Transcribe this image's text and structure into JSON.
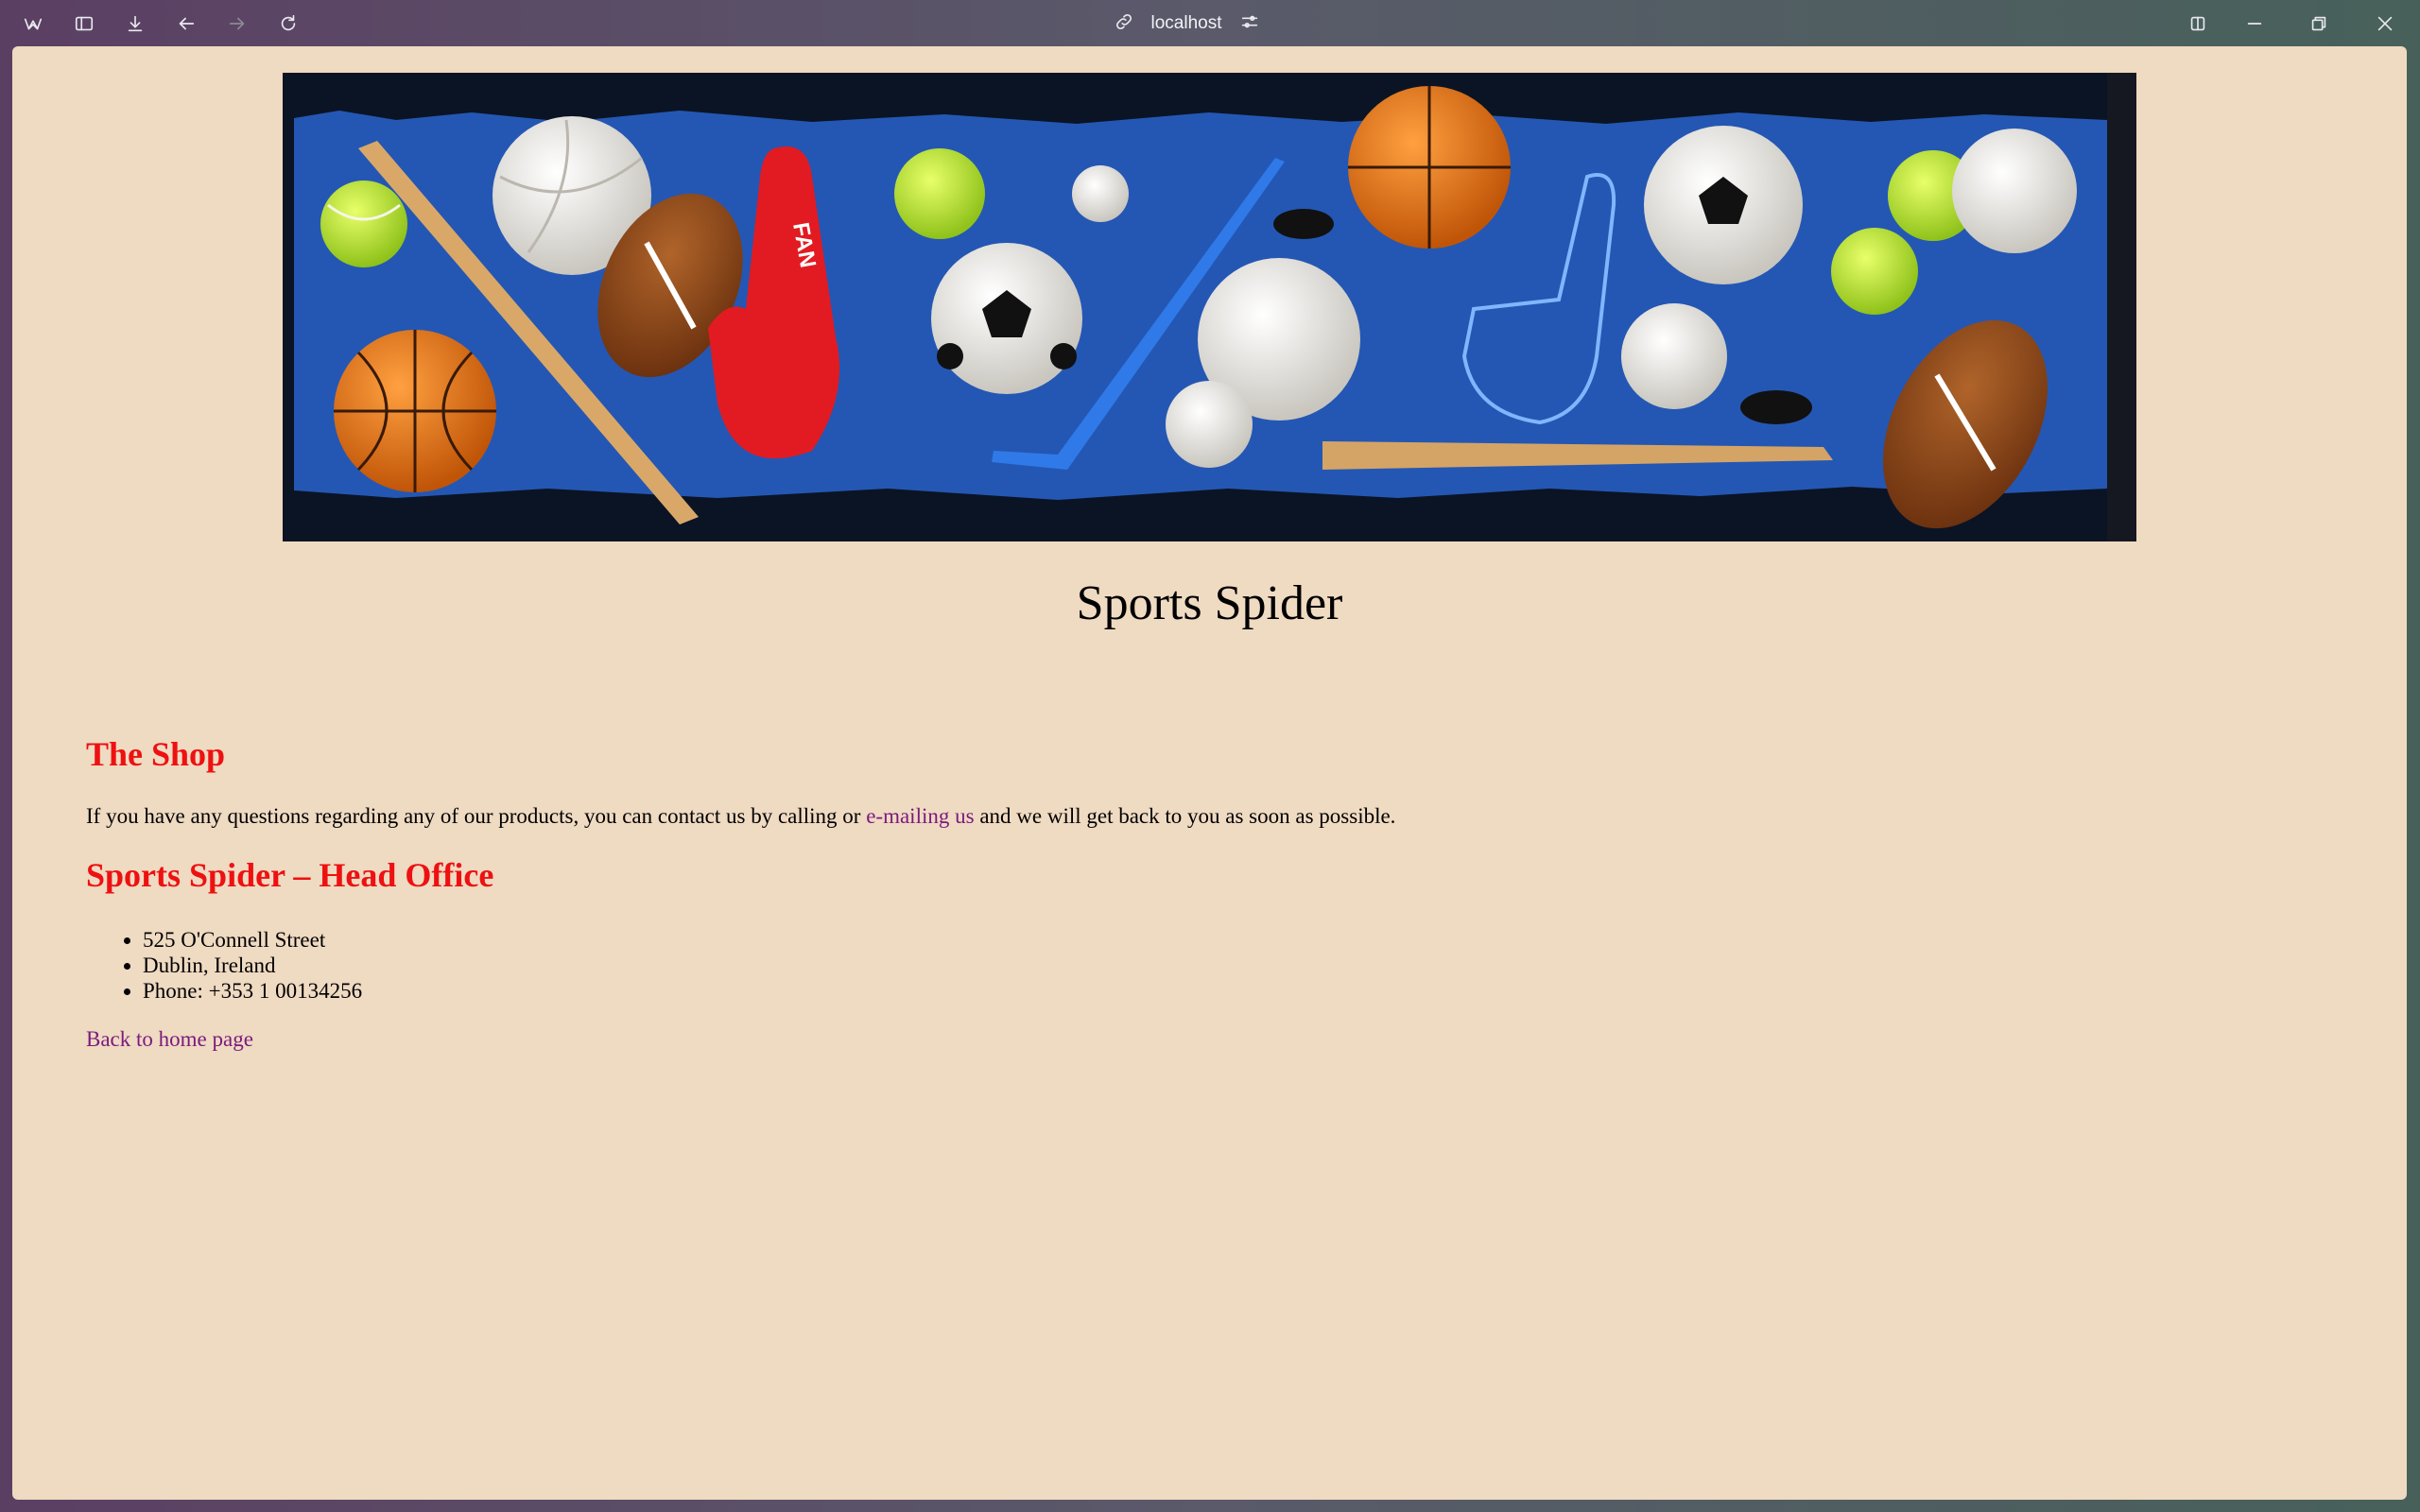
{
  "browser": {
    "url": "localhost",
    "icons": [
      "app-logo-icon",
      "sidebar-icon",
      "download-icon",
      "back-icon",
      "forward-icon",
      "reload-icon",
      "link-icon",
      "site-settings-icon",
      "split-view-icon",
      "minimize-icon",
      "maximize-icon",
      "close-icon"
    ]
  },
  "page": {
    "title": "Sports Spider",
    "shop_heading": "The Shop",
    "intro_before": "If you have any questions regarding any of our products, you can contact us by calling or ",
    "intro_link": "e-mailing us",
    "intro_after": " and we will get back to you as soon as possible.",
    "office_heading": "Sports Spider – Head Office",
    "office_items": [
      "525 O'Connell Street",
      "Dublin, Ireland",
      "Phone: +353 1 00134256"
    ],
    "back_link": "Back to home page"
  },
  "banner": {
    "banner_text": "FAN"
  },
  "colors": {
    "background": "#efdac2",
    "heading": "#ee1111",
    "link": "#7b1a7d"
  }
}
